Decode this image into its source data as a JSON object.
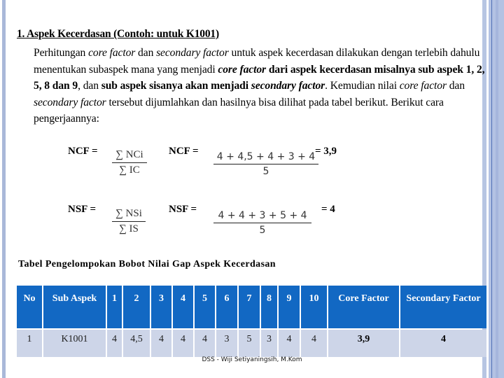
{
  "heading": "1. Aspek Kecerdasan (Contoh: untuk K1001)",
  "paragraph": [
    {
      "text": "Perhitungan ",
      "style": "normal"
    },
    {
      "text": "core factor",
      "style": "italic"
    },
    {
      "text": " dan ",
      "style": "normal"
    },
    {
      "text": "secondary factor",
      "style": "italic"
    },
    {
      "text": " untuk aspek kecerdasan dilakukan dengan terlebih dahulu menentukan subaspek mana yang menjadi ",
      "style": "normal"
    },
    {
      "text": "core factor",
      "style": "bold-italic"
    },
    {
      "text": " dari aspek kecerdasan misalnya sub aspek 1, 2, 5, 8 dan 9",
      "style": "bold"
    },
    {
      "text": ", dan ",
      "style": "normal"
    },
    {
      "text": "sub aspek sisanya akan menjadi",
      "style": "bold"
    },
    {
      "text": " ",
      "style": "normal"
    },
    {
      "text": "secondary factor",
      "style": "bold-italic"
    },
    {
      "text": ".  Kemudian nilai ",
      "style": "normal"
    },
    {
      "text": "core factor",
      "style": "italic"
    },
    {
      "text": " dan ",
      "style": "normal"
    },
    {
      "text": "secondary factor",
      "style": "italic"
    },
    {
      "text": " tersebut dijumlahkan dan hasilnya bisa dilihat pada tabel berikut. Berikut cara pengerjaannya:",
      "style": "normal"
    }
  ],
  "formulas": {
    "ncf": {
      "label": "NCF =",
      "generic_num": "∑ NCi",
      "generic_den": "∑ IC",
      "label2": "NCF =",
      "num": "4 + 4,5 + 4 + 3 + 4",
      "den": "5",
      "result": "= 3,9"
    },
    "nsf": {
      "label": "NSF =",
      "generic_num": "∑ NSi",
      "generic_den": "∑ IS",
      "label2": "NSF =",
      "num": "4  + 4 + 3 + 5 + 4",
      "den": "5",
      "result": "= 4"
    }
  },
  "table": {
    "caption": "Tabel  Pengelompokan Bobot Nilai Gap Aspek Kecerdasan",
    "headers": [
      "No",
      "Sub Aspek",
      "1",
      "2",
      "3",
      "4",
      "5",
      "6",
      "7",
      "8",
      "9",
      "10",
      "Core Factor",
      "Secondary Factor"
    ],
    "rows": [
      [
        "1",
        "K1001",
        "4",
        "4,5",
        "4",
        "4",
        "4",
        "3",
        "5",
        "3",
        "4",
        "4",
        "3,9",
        "4"
      ]
    ]
  },
  "footer": "DSS - Wiji Setiyaningsih, M.Kom",
  "colors": {
    "header_bg": "#1268c3",
    "row_bg": "#cdd5e8",
    "frame": "#b3c2e3"
  }
}
